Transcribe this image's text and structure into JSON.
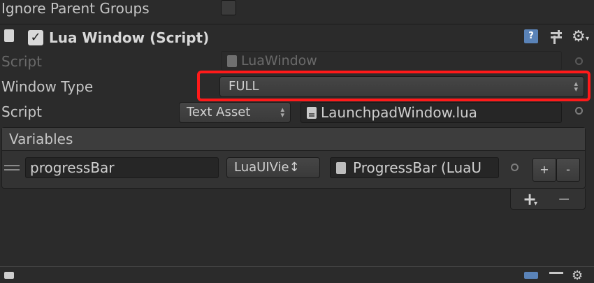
{
  "top_row": {
    "label": "Ignore Parent Groups",
    "checked": false
  },
  "component": {
    "title": "Lua Window (Script)",
    "enabled": true,
    "icons": [
      "help-icon",
      "preset-icon",
      "settings-gear-icon"
    ]
  },
  "fields": {
    "script": {
      "label": "Script",
      "value": "LuaWindow"
    },
    "window_type": {
      "label": "Window Type",
      "value": "FULL"
    },
    "lua_script": {
      "label": "Script",
      "type_value": "Text Asset",
      "value": "LaunchpadWindow.lua"
    }
  },
  "variables": {
    "header": "Variables",
    "rows": [
      {
        "name": "progressBar",
        "type": "LuaUIVie↕",
        "value": "ProgressBar (LuaU"
      }
    ],
    "row_plus": "+",
    "row_minus": "-",
    "add_label": "+",
    "remove_label": "−"
  },
  "colors": {
    "highlight": "#ff1a1a",
    "background": "#2b2b2b"
  }
}
